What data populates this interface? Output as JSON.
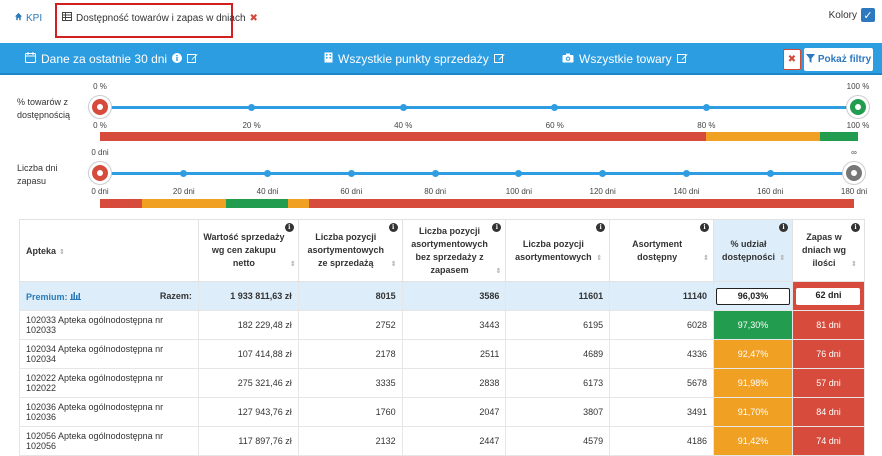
{
  "tabs": {
    "kpi_label": "KPI",
    "active_label": "Dostępność towarów i zapas w dniach"
  },
  "colors_toggle": {
    "label": "Kolory",
    "checked": true
  },
  "filter_bar": {
    "period": "Dane za ostatnie 30 dni",
    "points": "Wszystkie punkty sprzedaży",
    "goods": "Wszystkie towary",
    "show_filters": "Pokaż filtry"
  },
  "slider_availability": {
    "label": "% towarów z dostępnością",
    "handle_min_label": "0 %",
    "handle_max_label": "100 %",
    "ticks": [
      "0 %",
      "20 %",
      "40 %",
      "60 %",
      "80 %",
      "100 %"
    ],
    "range": [
      0,
      100
    ],
    "colorbar": [
      {
        "from": 0,
        "to": 80,
        "color": "#d64b3b"
      },
      {
        "from": 80,
        "to": 95,
        "color": "#f0a023"
      },
      {
        "from": 95,
        "to": 100,
        "color": "#229c4f"
      }
    ]
  },
  "slider_days": {
    "label": "Liczba dni zapasu",
    "handle_min_label": "0 dni",
    "handle_max_label": "∞",
    "ticks": [
      "0 dni",
      "20 dni",
      "40 dni",
      "60 dni",
      "80 dni",
      "100 dni",
      "120 dni",
      "140 dni",
      "160 dni",
      "180 dni"
    ],
    "range": [
      0,
      180
    ],
    "colorbar": [
      {
        "from": 0,
        "to": 10,
        "color": "#d64b3b"
      },
      {
        "from": 10,
        "to": 30,
        "color": "#f0a023"
      },
      {
        "from": 30,
        "to": 45,
        "color": "#229c4f"
      },
      {
        "from": 45,
        "to": 50,
        "color": "#f0a023"
      },
      {
        "from": 50,
        "to": 180,
        "color": "#d64b3b"
      }
    ]
  },
  "table": {
    "headers": [
      "Apteka",
      "Wartość sprzedaży wg cen zakupu netto",
      "Liczba pozycji asortymentowych ze sprzedażą",
      "Liczba pozycji asortymentowych bez sprzedaży z zapasem",
      "Liczba pozycji asortymentowych",
      "Asortyment dostępny",
      "% udział dostępności",
      "Zapas w dniach wg ilości"
    ],
    "summary": {
      "premium": "Premium:",
      "razem": "Razem:",
      "sales": "1 933 811,63 zł",
      "with_sales": "8015",
      "without_sales": "3586",
      "positions": "11601",
      "available": "11140",
      "pct": "96,03%",
      "days": "62 dni"
    },
    "rows": [
      {
        "name": "102033 Apteka ogólnodostępna nr 102033",
        "sales": "182 229,48 zł",
        "with_sales": "2752",
        "without_sales": "3443",
        "positions": "6195",
        "available": "6028",
        "pct": "97,30%",
        "pct_color": "#229c4f",
        "days": "81 dni",
        "days_color": "#d64b3b"
      },
      {
        "name": "102034 Apteka ogólnodostępna nr 102034",
        "sales": "107 414,88 zł",
        "with_sales": "2178",
        "without_sales": "2511",
        "positions": "4689",
        "available": "4336",
        "pct": "92,47%",
        "pct_color": "#f0a023",
        "days": "76 dni",
        "days_color": "#d64b3b"
      },
      {
        "name": "102022 Apteka ogólnodostępna nr 102022",
        "sales": "275 321,46 zł",
        "with_sales": "3335",
        "without_sales": "2838",
        "positions": "6173",
        "available": "5678",
        "pct": "91,98%",
        "pct_color": "#f0a023",
        "days": "57 dni",
        "days_color": "#d64b3b"
      },
      {
        "name": "102036 Apteka ogólnodostępna nr 102036",
        "sales": "127 943,76 zł",
        "with_sales": "1760",
        "without_sales": "2047",
        "positions": "3807",
        "available": "3491",
        "pct": "91,70%",
        "pct_color": "#f0a023",
        "days": "84 dni",
        "days_color": "#d64b3b"
      },
      {
        "name": "102056 Apteka ogólnodostępna nr 102056",
        "sales": "117 897,76 zł",
        "with_sales": "2132",
        "without_sales": "2447",
        "positions": "4579",
        "available": "4186",
        "pct": "91,42%",
        "pct_color": "#f0a023",
        "days": "74 dni",
        "days_color": "#d64b3b"
      }
    ]
  },
  "accent_colors": {
    "blue": "#2d9de1",
    "red": "#d64b3b",
    "orange": "#f0a023",
    "green": "#229c4f",
    "gray": "#777777"
  }
}
